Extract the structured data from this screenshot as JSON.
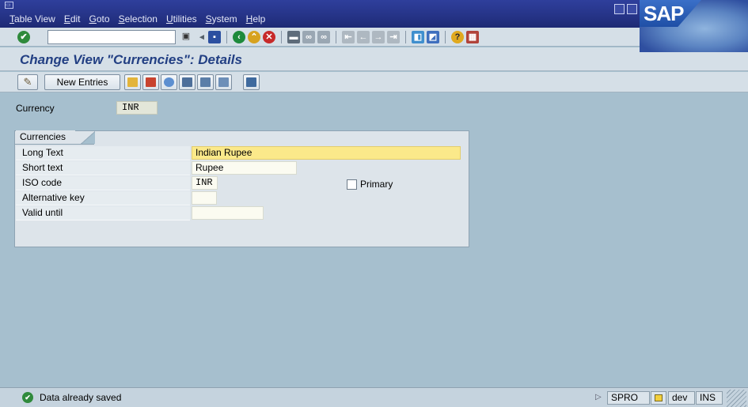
{
  "menu": {
    "items": [
      {
        "label": "Table View"
      },
      {
        "label": "Edit"
      },
      {
        "label": "Goto"
      },
      {
        "label": "Selection"
      },
      {
        "label": "Utilities"
      },
      {
        "label": "System"
      },
      {
        "label": "Help"
      }
    ],
    "logo": "SAP"
  },
  "toolbar": {
    "command_value": "",
    "icons": [
      "back-icon",
      "exit-icon",
      "cancel-icon",
      "print-icon",
      "find-icon",
      "find-next-icon",
      "first-page-icon",
      "previous-page-icon",
      "next-page-icon",
      "last-page-icon",
      "create-session-icon",
      "shortcut-icon",
      "help-icon",
      "layout-icon"
    ]
  },
  "title": "Change View \"Currencies\": Details",
  "app_toolbar": {
    "new_entries_label": "New Entries"
  },
  "currency": {
    "label": "Currency",
    "value": "INR"
  },
  "group": {
    "title": "Currencies",
    "fields": {
      "long_text": {
        "label": "Long Text",
        "value": "Indian Rupee"
      },
      "short_text": {
        "label": "Short text",
        "value": "Rupee"
      },
      "iso_code": {
        "label": "ISO code",
        "value": "INR"
      },
      "alternative_key": {
        "label": "Alternative key",
        "value": ""
      },
      "valid_until": {
        "label": "Valid until",
        "value": ""
      }
    },
    "primary_label": "Primary",
    "primary_checked": false
  },
  "status": {
    "message": "Data already saved",
    "tcode": "SPRO",
    "system": "dev",
    "mode": "INS"
  },
  "colors": {
    "background": "#a6bfce",
    "menubar": "#253386",
    "title_text": "#223f83",
    "required_field": "#fbe98a"
  }
}
